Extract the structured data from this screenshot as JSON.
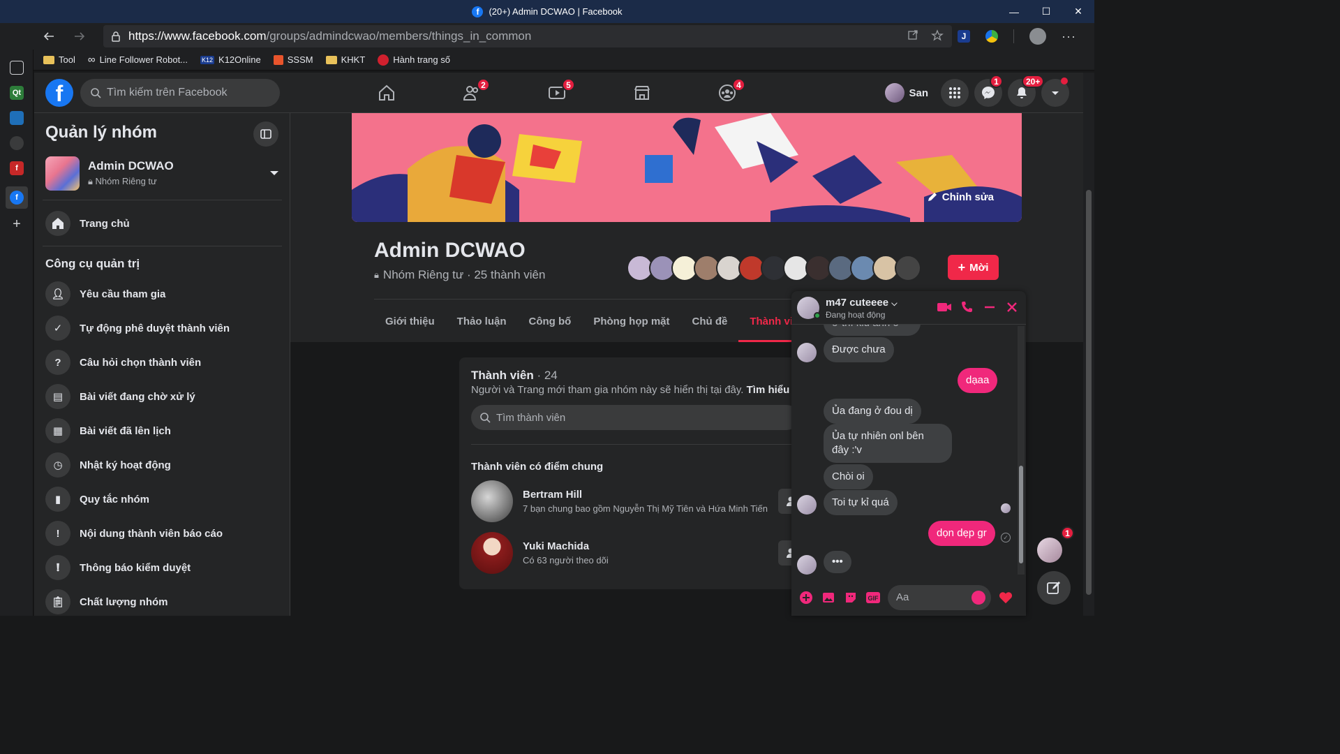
{
  "window": {
    "title": "(20+) Admin DCWAO | Facebook",
    "minimize": "—",
    "maximize": "☐",
    "close": "✕"
  },
  "browser": {
    "url_host": "https://www.facebook.com",
    "url_path": "/groups/admindcwao/members/things_in_common",
    "bookmarks": [
      "Tool",
      "Line Follower Robot...",
      "K12Online",
      "SSSM",
      "KHKT",
      "Hành trang số"
    ]
  },
  "fb_top": {
    "search_placeholder": "Tìm kiếm trên Facebook",
    "friends_badge": "2",
    "watch_badge": "5",
    "groups_badge": "4",
    "profile_name": "San",
    "messenger_badge": "1",
    "notifications_badge": "20+"
  },
  "left": {
    "title": "Quản lý nhóm",
    "group_name": "Admin DCWAO",
    "group_privacy": "Nhóm Riêng tư",
    "home": "Trang chủ",
    "section": "Công cụ quản trị",
    "items": [
      "Yêu cầu tham gia",
      "Tự động phê duyệt thành viên",
      "Câu hỏi chọn thành viên",
      "Bài viết đang chờ xử lý",
      "Bài viết đã lên lịch",
      "Nhật ký hoạt động",
      "Quy tắc nhóm",
      "Nội dung thành viên báo cáo",
      "Thông báo kiểm duyệt",
      "Chất lượng nhóm"
    ]
  },
  "group": {
    "edit_cover": "Chỉnh sửa",
    "title": "Admin DCWAO",
    "meta": "Nhóm Riêng tư · 25 thành viên",
    "new_button": "Mời",
    "tabs": [
      "Giới thiệu",
      "Thảo luận",
      "Công bố",
      "Phòng họp mặt",
      "Chủ đề",
      "Thành viên"
    ],
    "active_tab": "Thành viên"
  },
  "members": {
    "title": "Thành viên",
    "count": " · 24",
    "desc": "Người và Trang mới tham gia nhóm này sẽ hiển thị tại đây. ",
    "learn_more": "Tìm hiểu thêm",
    "search_placeholder": "Tìm thành viên",
    "subtitle": "Thành viên có điểm chung",
    "list": [
      {
        "name": "Bertram Hill",
        "sub": "7 bạn chung bao gồm Nguyễn Thị Mỹ Tiên và Hứa Minh Tiến"
      },
      {
        "name": "Yuki Machida",
        "sub": "Có 63 người theo dõi"
      }
    ]
  },
  "chat": {
    "name": "m47 cuteeee",
    "status": "Đang hoạt động",
    "partial_top": "ờ thì kiu anh ờ ^^",
    "messages": [
      {
        "dir": "in",
        "text": "Được chưa"
      },
      {
        "dir": "out",
        "text": "dạaa"
      },
      {
        "dir": "in",
        "text": "Ủa đang ở đou dị"
      },
      {
        "dir": "in",
        "text": "Ủa tự nhiên onl bên đây :'v"
      },
      {
        "dir": "in",
        "text": "Chòi oi"
      },
      {
        "dir": "in",
        "text": "Toi tự kỉ quá"
      },
      {
        "dir": "out",
        "text": "dọn dẹp gr"
      }
    ],
    "typing": "•••",
    "input_placeholder": "Aa"
  },
  "floating": {
    "badge": "1"
  },
  "colors": {
    "accent": "#f02849",
    "chat_out": "#f0287b",
    "fb_blue": "#1877f2",
    "bg": "#18191a",
    "surface": "#242526"
  }
}
